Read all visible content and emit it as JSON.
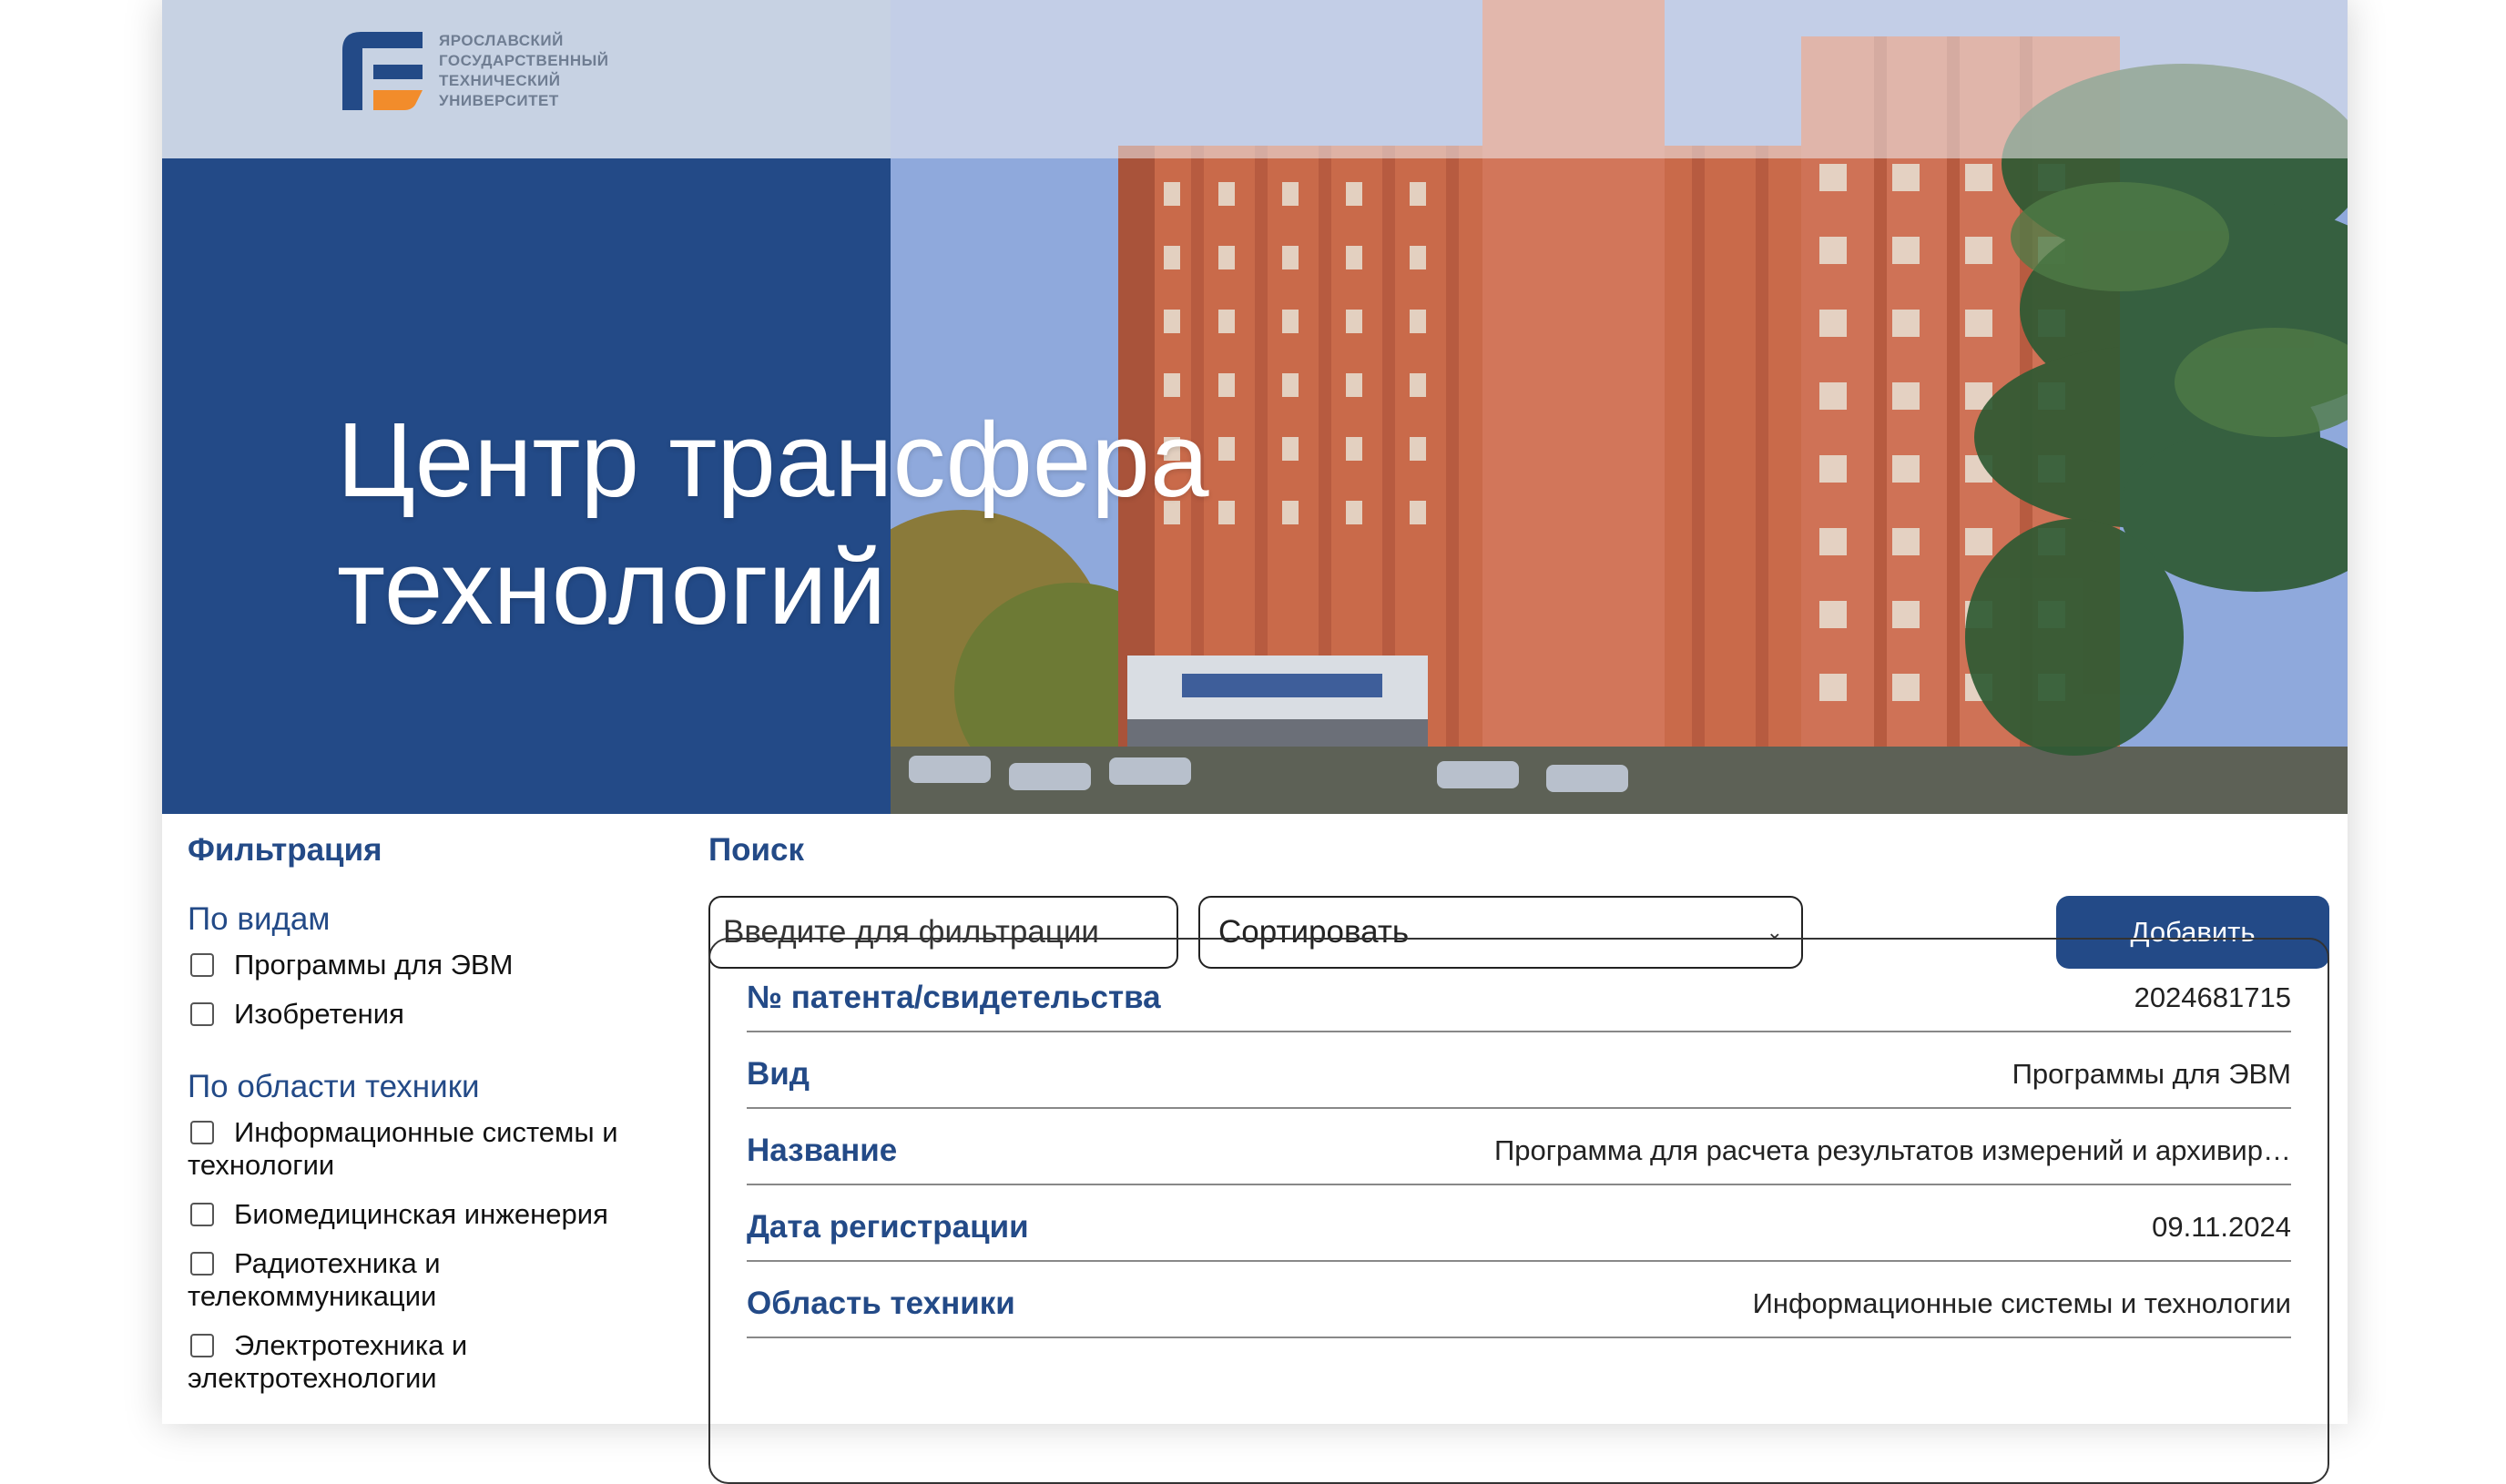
{
  "brand": {
    "logo_lines": [
      "ЯРОСЛАВСКИЙ",
      "ГОСУДАРСТВЕННЫЙ",
      "ТЕХНИЧЕСКИЙ",
      "УНИВЕРСИТЕТ"
    ],
    "accent_blue": "#234a87",
    "accent_orange": "#f28c2b"
  },
  "hero": {
    "title_line1": "Центр трансфера",
    "title_line2": "технологий"
  },
  "sidebar": {
    "title": "Фильтрация",
    "by_type": {
      "title": "По видам",
      "items": [
        "Программы для ЭВМ",
        "Изобретения"
      ]
    },
    "by_field": {
      "title": "По области техники",
      "items": [
        [
          "Информационные системы и",
          "технологии"
        ],
        [
          "Биомедицинская инженерия"
        ],
        [
          "Радиотехника и",
          "телекоммуникации"
        ],
        [
          "Электротехника и",
          "электротехнологии"
        ]
      ]
    }
  },
  "search": {
    "title": "Поиск",
    "placeholder": "Введите для фильтрации",
    "sort_label": "Сортировать",
    "add_label": "Добавить"
  },
  "record": {
    "rows": [
      {
        "key": "№ патента/свидетельства",
        "value": "2024681715"
      },
      {
        "key": "Вид",
        "value": "Программы для ЭВМ"
      },
      {
        "key": "Название",
        "value": "Программа для расчета результатов измерений и архивир…"
      },
      {
        "key": "Дата регистрации",
        "value": "09.11.2024"
      },
      {
        "key": "Область техники",
        "value": "Информационные системы и технологии"
      }
    ]
  }
}
